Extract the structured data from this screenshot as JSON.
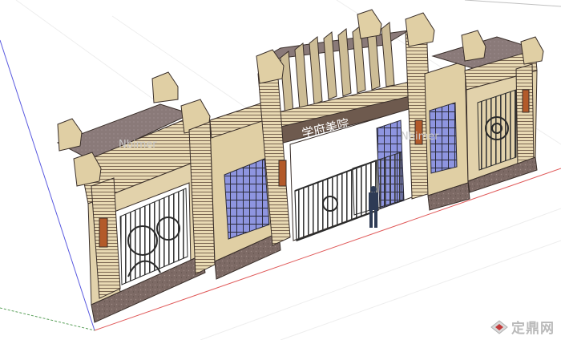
{
  "viewport": {
    "sign_text": "学府美院",
    "watermark_text": "Nbimer",
    "site_watermark": "定鼎网",
    "colors": {
      "background": "#ffffff",
      "roof": "#8a7a79",
      "stone_light": "#e8d9b3",
      "stone_mid": "#c9b58c",
      "stone_dark": "#4a3a30",
      "granite": "#7d6a65",
      "window_glass": "#7f86d6",
      "iron": "#3a3a3a",
      "axis_red": "#e05a5a",
      "axis_green": "#5aa05a",
      "axis_blue": "#5a5ae0"
    }
  }
}
